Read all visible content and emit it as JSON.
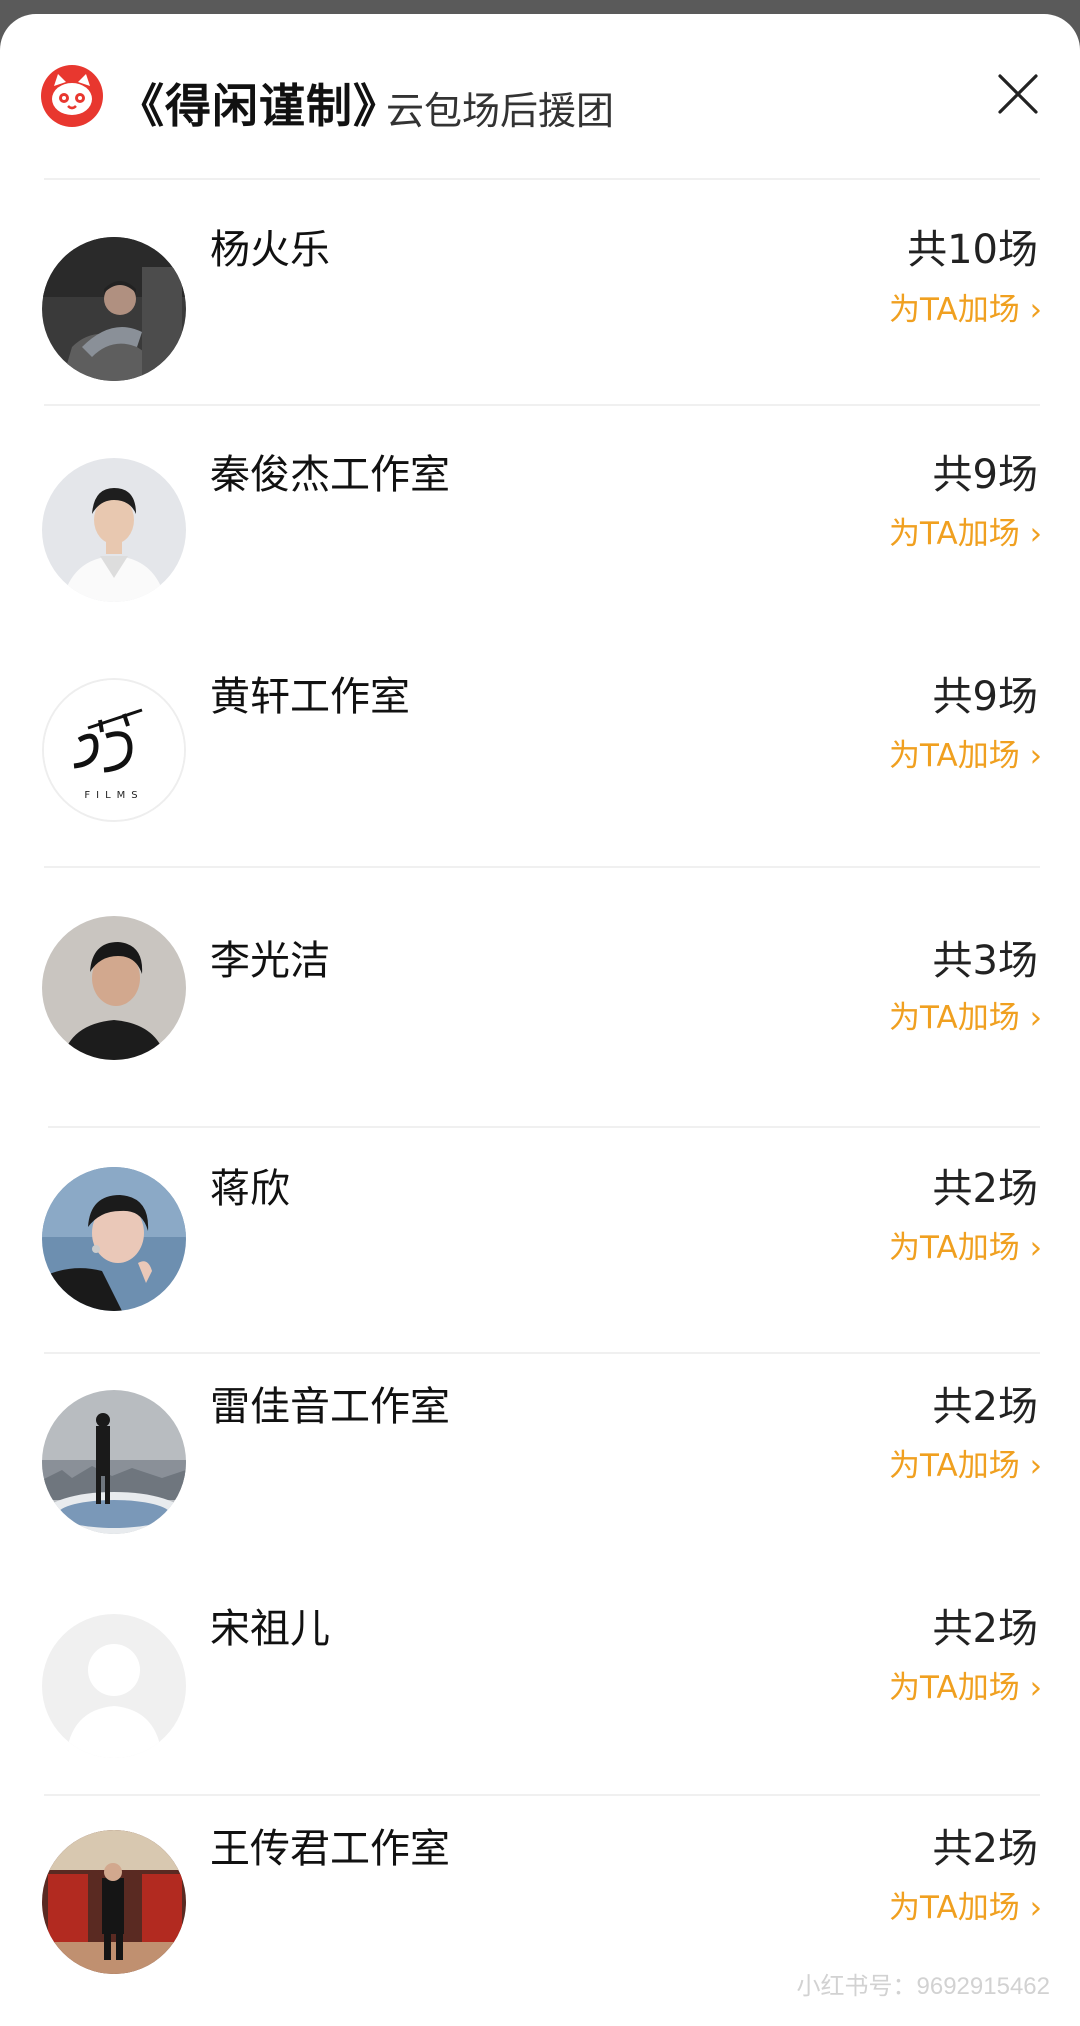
{
  "header": {
    "title": "《得闲谨制》",
    "subtitle": "云包场后援团"
  },
  "items": [
    {
      "name": "杨火乐",
      "count": "共10场",
      "action": "为TA加场 ›"
    },
    {
      "name": "秦俊杰工作室",
      "count": "共9场",
      "action": "为TA加场 ›"
    },
    {
      "name": "黄轩工作室",
      "count": "共9场",
      "action": "为TA加场 ›"
    },
    {
      "name": "李光洁",
      "count": "共3场",
      "action": "为TA加场 ›"
    },
    {
      "name": "蒋欣",
      "count": "共2场",
      "action": "为TA加场 ›"
    },
    {
      "name": "雷佳音工作室",
      "count": "共2场",
      "action": "为TA加场 ›"
    },
    {
      "name": "宋祖儿",
      "count": "共2场",
      "action": "为TA加场 ›"
    },
    {
      "name": "王传君工作室",
      "count": "共2场",
      "action": "为TA加场 ›"
    }
  ],
  "studio_logo_text": "FILMS",
  "watermark": "小红书号：9692915462",
  "colors": {
    "accent": "#f0a020",
    "logo_red": "#e8372f"
  }
}
